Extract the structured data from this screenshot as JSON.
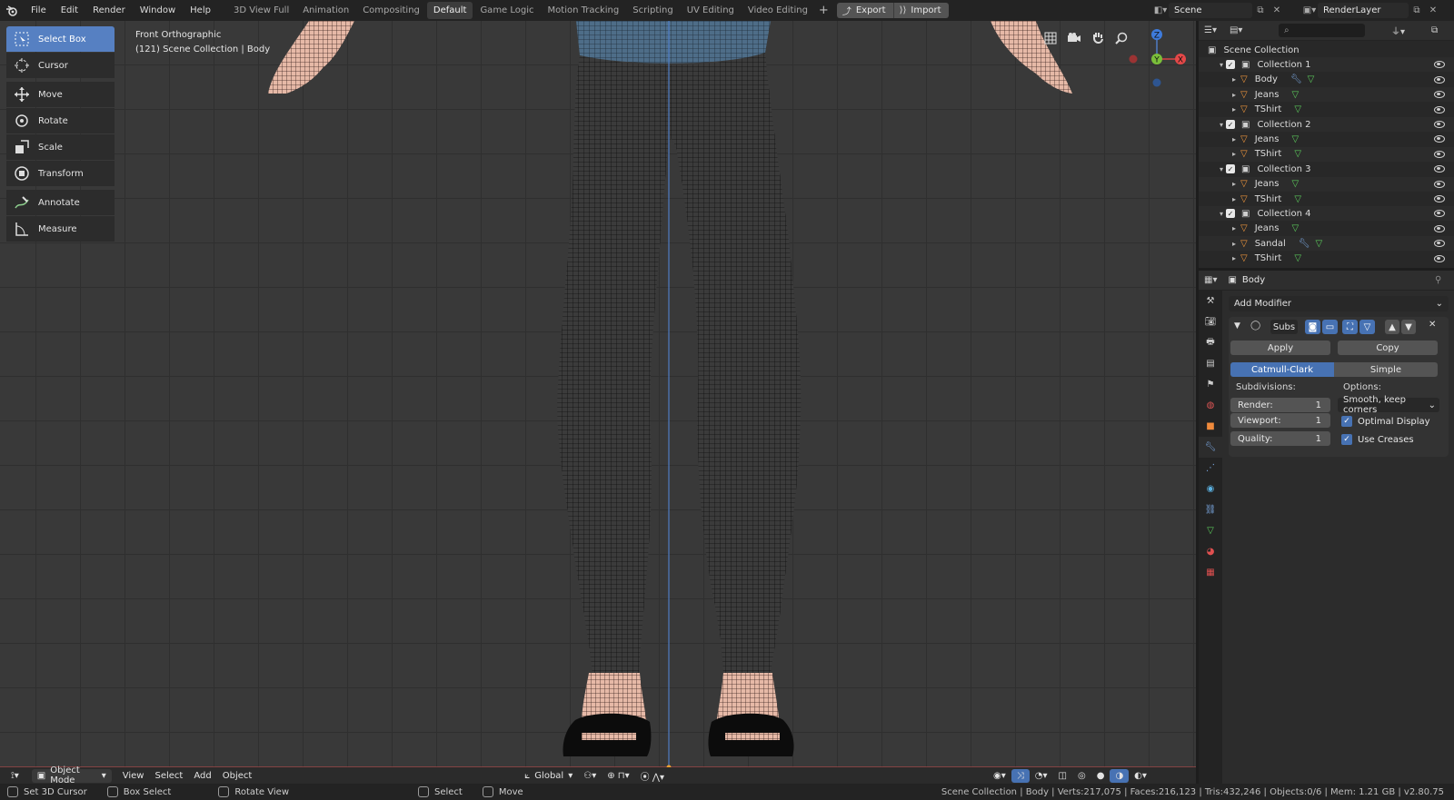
{
  "app": {
    "name": "Blender"
  },
  "menu": [
    "File",
    "Edit",
    "Render",
    "Window",
    "Help"
  ],
  "workspaces": [
    {
      "label": "3D View Full",
      "active": false
    },
    {
      "label": "Animation",
      "active": false
    },
    {
      "label": "Compositing",
      "active": false
    },
    {
      "label": "Default",
      "active": true
    },
    {
      "label": "Game Logic",
      "active": false
    },
    {
      "label": "Motion Tracking",
      "active": false
    },
    {
      "label": "Scripting",
      "active": false
    },
    {
      "label": "UV Editing",
      "active": false
    },
    {
      "label": "Video Editing",
      "active": false
    }
  ],
  "export_label": "Export",
  "import_label": "Import",
  "scene": {
    "name": "Scene",
    "render_layer": "RenderLayer"
  },
  "viewport": {
    "view_name": "Front Orthographic",
    "collection_info": "(121) Scene Collection | Body"
  },
  "tools": [
    {
      "label": "Select Box",
      "icon": "select-box-icon",
      "selected": true
    },
    {
      "label": "Cursor",
      "icon": "cursor-icon"
    },
    {
      "label": "Move",
      "icon": "move-icon"
    },
    {
      "label": "Rotate",
      "icon": "rotate-icon"
    },
    {
      "label": "Scale",
      "icon": "scale-icon"
    },
    {
      "label": "Transform",
      "icon": "transform-icon"
    },
    {
      "label": "Annotate",
      "icon": "annotate-icon"
    },
    {
      "label": "Measure",
      "icon": "measure-icon"
    }
  ],
  "gizmo": {
    "x": "X",
    "y": "Y",
    "z": "Z"
  },
  "header": {
    "mode": "Object Mode",
    "view": "View",
    "select": "Select",
    "add": "Add",
    "object": "Object",
    "orientation": "Global"
  },
  "outliner": {
    "root": "Scene Collection",
    "collections": [
      {
        "name": "Collection 1",
        "objects": [
          "Body",
          "Jeans",
          "TShirt"
        ]
      },
      {
        "name": "Collection 2",
        "objects": [
          "Jeans",
          "TShirt"
        ]
      },
      {
        "name": "Collection 3",
        "objects": [
          "Jeans",
          "TShirt"
        ]
      },
      {
        "name": "Collection 4",
        "objects": [
          "Jeans",
          "Sandal",
          "TShirt"
        ]
      }
    ]
  },
  "properties": {
    "object_name": "Body",
    "add_modifier": "Add Modifier",
    "modifier": {
      "name": "Subs",
      "apply": "Apply",
      "copy": "Copy",
      "type_catmull": "Catmull-Clark",
      "type_simple": "Simple",
      "subdivisions_label": "Subdivisions:",
      "options_label": "Options:",
      "render_label": "Render:",
      "render_value": "1",
      "viewport_label": "Viewport:",
      "viewport_value": "1",
      "quality_label": "Quality:",
      "quality_value": "1",
      "uv_smooth": "Smooth, keep corners",
      "optimal_display": "Optimal Display",
      "use_creases": "Use Creases"
    }
  },
  "statusbar": {
    "left1": "Set 3D Cursor",
    "left2": "Box Select",
    "left3": "Rotate View",
    "mid1": "Select",
    "mid2": "Move",
    "right": "Scene Collection | Body | Verts:217,075 | Faces:216,123 | Tris:432,246 | Objects:0/6 | Mem: 1.21 GB | v2.80.75"
  },
  "colors": {
    "accent": "#4772b3",
    "selected_tool": "#5680c2",
    "grid_bg": "#393939"
  }
}
